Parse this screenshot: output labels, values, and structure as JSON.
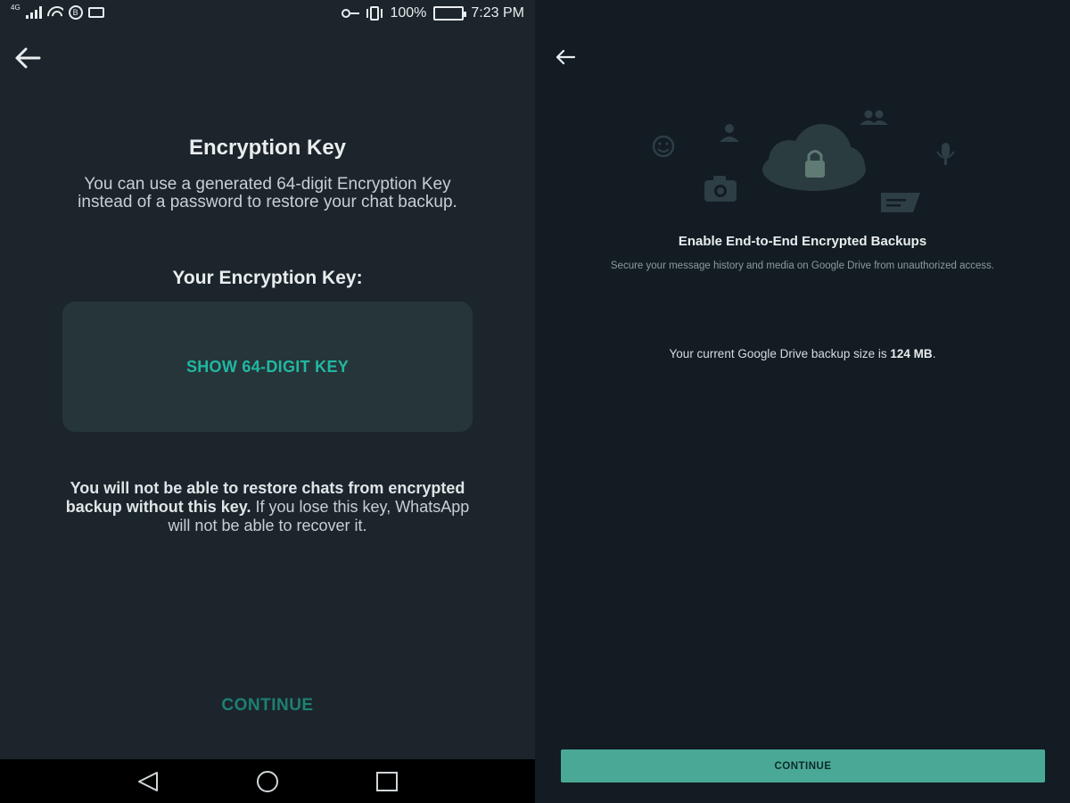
{
  "status_bar": {
    "network": "4G",
    "hd_badge": "B",
    "battery": "100%",
    "time": "7:23 PM"
  },
  "left_screen": {
    "title": "Encryption Key",
    "description": "You can use a generated 64-digit Encryption Key instead of a password to restore your chat backup.",
    "subtitle": "Your Encryption Key:",
    "show_key_button": "SHOW 64-DIGIT KEY",
    "warning_bold": "You will not be able to restore chats from encrypted backup without this key.",
    "warning_rest": " If you lose this key, WhatsApp will not be able to recover it.",
    "continue_label": "CONTINUE",
    "nav": [
      "back-icon",
      "home-icon",
      "recents-icon"
    ]
  },
  "right_screen": {
    "title": "Enable End-to-End Encrypted Backups",
    "description": "Secure your message history and media on Google Drive from unauthorized access.",
    "backup_size_prefix": "Your current Google Drive backup size is ",
    "backup_size_value": "124 MB",
    "backup_size_suffix": ".",
    "continue_label": "CONTINUE",
    "illustration_icons": [
      "emoji-icon",
      "person-icon",
      "group-icon",
      "camera-icon",
      "cloud-lock-icon",
      "mic-icon",
      "message-icon"
    ]
  },
  "colors": {
    "accent": "#20b8a2",
    "continue_disabled": "#1f7f72",
    "continue_button_bg": "#4aa996",
    "left_bg": "#1b252b",
    "right_bg": "#121c22",
    "keybox_bg": "#263539"
  }
}
